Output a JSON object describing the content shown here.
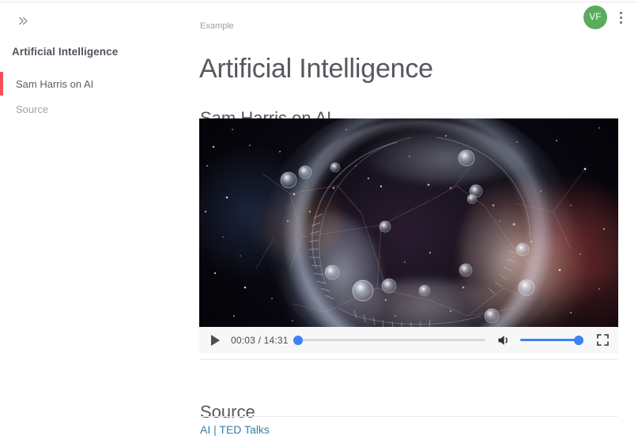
{
  "sidebar": {
    "toggle_icon": "chevron-double-right-icon",
    "title": "Artificial Intelligence",
    "items": [
      {
        "label": "Sam Harris on AI",
        "active": true
      },
      {
        "label": "Source",
        "active": false
      }
    ]
  },
  "header": {
    "breadcrumb": "Example",
    "title": "Artificial Intelligence",
    "avatar_initials": "VF",
    "avatar_color": "#5aab5c",
    "overflow_icon": "more-vertical-icon"
  },
  "sections": {
    "video": {
      "heading": "Sam Harris on AI"
    },
    "source": {
      "heading": "Source",
      "link_text": "AI | TED Talks",
      "link_color": "#3d7ea6"
    }
  },
  "player": {
    "play_icon": "play-icon",
    "time_display": "00:03 / 14:31",
    "current_time": "00:03",
    "duration": "14:31",
    "progress_percent": 0.34,
    "volume_icon": "volume-medium-icon",
    "volume_percent": 92,
    "fullscreen_icon": "fullscreen-icon",
    "accent_color": "#3b82f6"
  },
  "theme": {
    "active_accent": "#f4505a",
    "text_primary": "#55595e",
    "text_muted": "#9aa0a8"
  }
}
